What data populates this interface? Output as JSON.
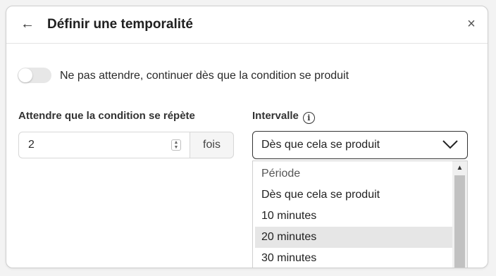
{
  "dialog": {
    "back_icon": "←",
    "title": "Définir une temporalité",
    "close_icon": "×"
  },
  "toggle": {
    "label": "Ne pas attendre, continuer dès que la condition se produit",
    "on": false
  },
  "repeat": {
    "label": "Attendre que la condition se répète",
    "value": "2",
    "unit": "fois"
  },
  "interval": {
    "label": "Intervalle",
    "info_icon": "i",
    "selected": "Dès que cela se produit",
    "options": [
      "Période",
      "Dès que cela se produit",
      "10 minutes",
      "20 minutes",
      "30 minutes"
    ],
    "highlighted": "20 minutes"
  },
  "colors": {
    "background": "#f3f3f3",
    "highlight": "#e6e6e6"
  }
}
